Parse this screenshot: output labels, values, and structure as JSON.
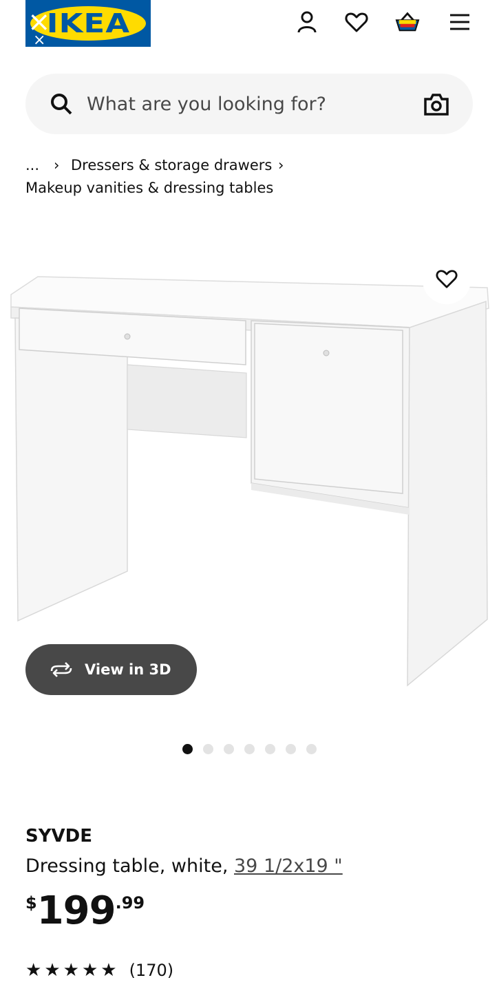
{
  "header": {
    "logo_text": "IKEA",
    "icons": [
      "user-icon",
      "heart-icon",
      "basket-icon",
      "menu-icon"
    ],
    "brand_colors": {
      "blue": "#0058a3",
      "yellow": "#ffdb00"
    }
  },
  "search": {
    "placeholder": "What are you looking for?"
  },
  "breadcrumb": {
    "ellipsis": "...",
    "separator": "›",
    "items": [
      "Dressers & storage drawers",
      "Makeup vanities & dressing tables"
    ]
  },
  "media": {
    "view_3d_label": "View in 3D",
    "carousel_count": 7,
    "carousel_active_index": 0
  },
  "product": {
    "name": "SYVDE",
    "description": "Dressing table, white,",
    "dimensions": "39 1/2x19 \"",
    "price_currency": "$",
    "price_integer": "199",
    "price_decimal": ".99",
    "rating_stars": 5,
    "review_count": "(170)"
  }
}
